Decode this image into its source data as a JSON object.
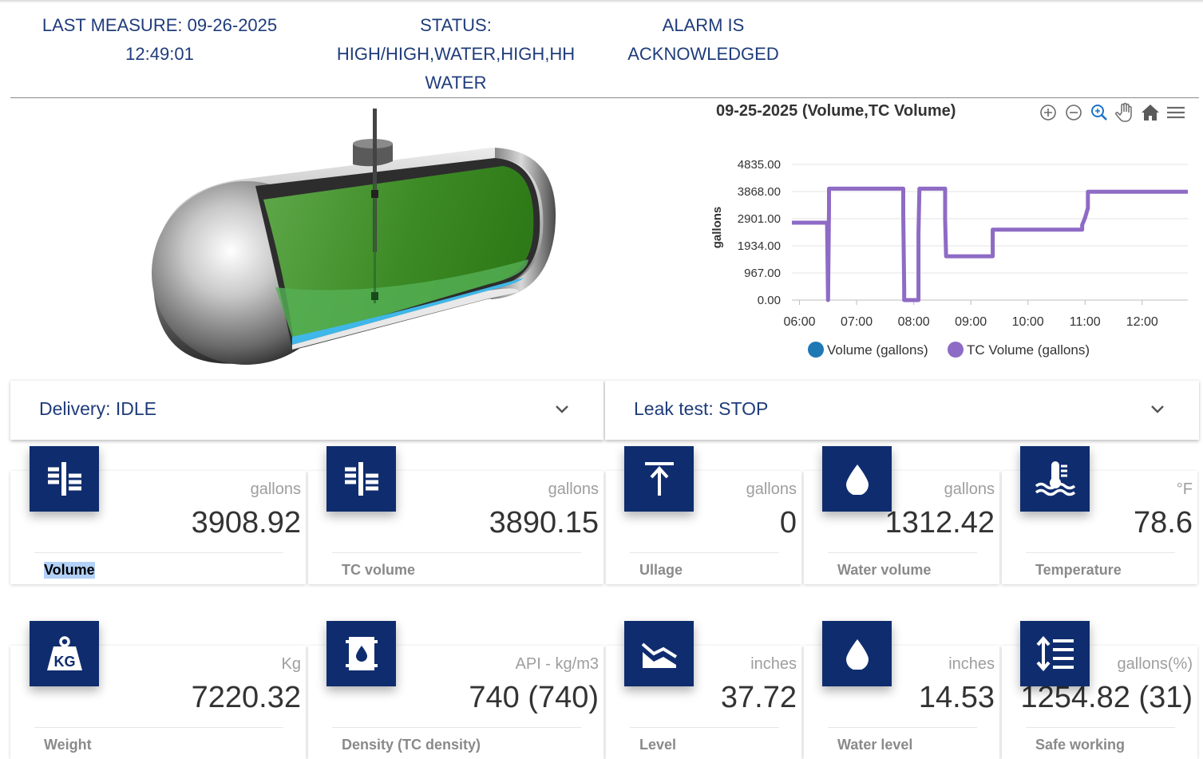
{
  "header": {
    "last_measure_line1": "LAST MEASURE: 09-26-2025",
    "last_measure_line2": "12:49:01",
    "status_line1": "STATUS:",
    "status_line2": "HIGH/HIGH,WATER,HIGH,HH",
    "status_line3": "WATER",
    "alarm_line1": "ALARM IS",
    "alarm_line2": "ACKNOWLEDGED"
  },
  "toolbar": {
    "icons": [
      "zoom-in-icon",
      "zoom-out-icon",
      "zoom-selection-icon",
      "pan-icon",
      "home-icon",
      "menu-icon"
    ]
  },
  "panels": {
    "delivery": "Delivery: IDLE",
    "leak_test": "Leak test: STOP"
  },
  "cards_row1": [
    {
      "icon": "volume-icon",
      "unit": "gallons",
      "value": "3908.92",
      "label": "Volume"
    },
    {
      "icon": "tc-volume-icon",
      "unit": "gallons",
      "value": "3890.15",
      "label": "TC volume"
    },
    {
      "icon": "ullage-icon",
      "unit": "gallons",
      "value": "0",
      "label": "Ullage"
    },
    {
      "icon": "water-drop-icon",
      "unit": "gallons",
      "value": "1312.42",
      "label": "Water volume"
    },
    {
      "icon": "temperature-icon",
      "unit": "°F",
      "value": "78.6",
      "label": "Temperature"
    }
  ],
  "cards_row2": [
    {
      "icon": "weight-kg-icon",
      "unit": "Kg",
      "value": "7220.32",
      "label": "Weight"
    },
    {
      "icon": "barrel-icon",
      "unit": "API - kg/m3",
      "value": "740 (740)",
      "label": "Density (TC density)"
    },
    {
      "icon": "level-icon",
      "unit": "inches",
      "value": "37.72",
      "label": "Level"
    },
    {
      "icon": "water-drop-icon",
      "unit": "inches",
      "value": "14.53",
      "label": "Water level"
    },
    {
      "icon": "safe-working-icon",
      "unit": "gallons(%)",
      "value": "1254.82 (31)",
      "label": "Safe working"
    }
  ],
  "colors": {
    "header_text": "#1f3c7a",
    "icon_tile": "#0f2d6e",
    "series_volume": "#1f77b4",
    "series_tc_volume": "#8e6bc5"
  },
  "chart_data": {
    "type": "line",
    "title": "09-25-2025 (Volume,TC Volume)",
    "ylabel": "gallons",
    "xlabel": "",
    "ylim": [
      0,
      4835
    ],
    "yticks": [
      "4835.00",
      "3868.00",
      "2901.00",
      "1934.00",
      "967.00",
      "0.00"
    ],
    "xticks": [
      "06:00",
      "07:00",
      "08:00",
      "09:00",
      "10:00",
      "11:00",
      "12:00"
    ],
    "legend": "bottom",
    "series": [
      {
        "name": "Volume (gallons)",
        "color": "#1f77b4",
        "x": [
          "05:52",
          "06:29",
          "06:29",
          "06:30",
          "06:30",
          "06:31",
          "06:31",
          "07:49",
          "07:49",
          "07:50",
          "07:50",
          "08:05",
          "08:05",
          "08:06",
          "08:06",
          "08:33",
          "08:33",
          "08:34",
          "08:34",
          "09:23",
          "09:23",
          "10:57",
          "10:57",
          "11:00",
          "11:00",
          "11:03",
          "11:03",
          "12:48"
        ],
        "y": [
          2780,
          2780,
          2700,
          0,
          0,
          3300,
          3990,
          3990,
          3100,
          400,
          0,
          0,
          2400,
          3990,
          3990,
          3990,
          2900,
          1600,
          1580,
          1580,
          2530,
          2530,
          2700,
          2950,
          2950,
          3300,
          3880,
          3880
        ]
      },
      {
        "name": "TC Volume (gallons)",
        "color": "#8e6bc5",
        "x": [
          "05:52",
          "06:29",
          "06:29",
          "06:30",
          "06:30",
          "06:31",
          "06:31",
          "07:49",
          "07:49",
          "07:50",
          "07:50",
          "08:05",
          "08:05",
          "08:06",
          "08:06",
          "08:33",
          "08:33",
          "08:34",
          "08:34",
          "09:23",
          "09:23",
          "10:57",
          "10:57",
          "11:00",
          "11:00",
          "11:03",
          "11:03",
          "12:48"
        ],
        "y": [
          2760,
          2760,
          2680,
          0,
          0,
          3280,
          3970,
          3970,
          3080,
          380,
          0,
          0,
          2380,
          3970,
          3970,
          3970,
          2880,
          1580,
          1560,
          1560,
          2510,
          2510,
          2680,
          2930,
          2930,
          3280,
          3860,
          3860
        ]
      }
    ]
  }
}
